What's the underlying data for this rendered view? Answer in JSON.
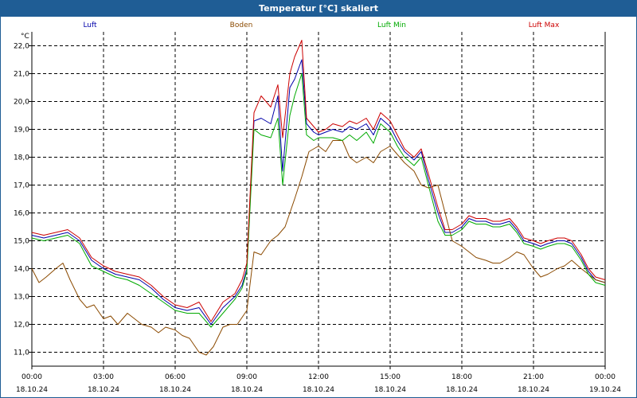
{
  "window": {
    "title": "Temperatur [°C] skaliert"
  },
  "chart_data": {
    "type": "line",
    "title": "Temperatur [°C] skaliert",
    "ylabel": "°C",
    "ylim": [
      10.5,
      22.5
    ],
    "yticks": [
      "11,0",
      "12,0",
      "13,0",
      "14,0",
      "15,0",
      "16,0",
      "17,0",
      "18,0",
      "19,0",
      "20,0",
      "21,0",
      "22,0"
    ],
    "ytick_values": [
      11,
      12,
      13,
      14,
      15,
      16,
      17,
      18,
      19,
      20,
      21,
      22
    ],
    "xlim": [
      0,
      24
    ],
    "xtick_values": [
      0,
      3,
      6,
      9,
      12,
      15,
      18,
      21,
      24
    ],
    "xticks_time": [
      "00:00",
      "03:00",
      "06:00",
      "09:00",
      "12:00",
      "15:00",
      "18:00",
      "21:00",
      "00:00"
    ],
    "xticks_date": [
      "18.10.24",
      "18.10.24",
      "18.10.24",
      "18.10.24",
      "18.10.24",
      "18.10.24",
      "18.10.24",
      "18.10.24",
      "19.10.24"
    ],
    "grid": true,
    "legend_position": "top",
    "series": [
      {
        "name": "Luft",
        "color": "#0000aa",
        "x": [
          0,
          0.5,
          1,
          1.5,
          2,
          2.5,
          3,
          3.5,
          4,
          4.5,
          5,
          5.5,
          6,
          6.5,
          7,
          7.5,
          8,
          8.5,
          8.8,
          9,
          9.3,
          9.6,
          10,
          10.3,
          10.5,
          10.8,
          11,
          11.3,
          11.5,
          11.8,
          12,
          12.3,
          12.6,
          13,
          13.3,
          13.6,
          14,
          14.3,
          14.6,
          15,
          15.3,
          15.6,
          16,
          16.3,
          16.6,
          17,
          17.3,
          17.6,
          18,
          18.3,
          18.6,
          19,
          19.3,
          19.6,
          20,
          20.3,
          20.6,
          21,
          21.3,
          21.6,
          22,
          22.3,
          22.6,
          23,
          23.3,
          23.6,
          24
        ],
        "y": [
          15.2,
          15.1,
          15.2,
          15.3,
          15.0,
          14.3,
          14.0,
          13.8,
          13.7,
          13.6,
          13.3,
          12.9,
          12.6,
          12.5,
          12.6,
          12.0,
          12.6,
          13.0,
          13.4,
          14.0,
          19.3,
          19.4,
          19.2,
          20.2,
          17.5,
          20.5,
          20.8,
          21.5,
          19.2,
          18.9,
          18.8,
          18.9,
          19.0,
          18.9,
          19.1,
          19.0,
          19.2,
          18.8,
          19.4,
          19.1,
          18.6,
          18.2,
          17.9,
          18.2,
          17.2,
          16.0,
          15.3,
          15.3,
          15.5,
          15.8,
          15.7,
          15.7,
          15.6,
          15.6,
          15.7,
          15.4,
          15.0,
          14.9,
          14.8,
          14.9,
          15.0,
          15.0,
          14.9,
          14.4,
          13.9,
          13.6,
          13.5
        ]
      },
      {
        "name": "Boden",
        "color": "#8b4a00",
        "x": [
          0,
          0.3,
          0.6,
          1,
          1.3,
          1.6,
          2,
          2.3,
          2.6,
          3,
          3.3,
          3.6,
          4,
          4.3,
          4.6,
          5,
          5.3,
          5.6,
          6,
          6.3,
          6.6,
          7,
          7.3,
          7.6,
          8,
          8.3,
          8.6,
          9,
          9.3,
          9.6,
          10,
          10.3,
          10.6,
          11,
          11.3,
          11.6,
          12,
          12.3,
          12.6,
          13,
          13.3,
          13.6,
          14,
          14.3,
          14.6,
          15,
          15.3,
          15.6,
          16,
          16.3,
          16.6,
          17,
          17.3,
          17.6,
          18,
          18.3,
          18.6,
          19,
          19.3,
          19.6,
          20,
          20.3,
          20.6,
          21,
          21.3,
          21.6,
          22,
          22.3,
          22.6,
          23,
          23.3,
          23.6,
          24
        ],
        "y": [
          14.0,
          13.5,
          13.7,
          14.0,
          14.2,
          13.6,
          12.9,
          12.6,
          12.7,
          12.2,
          12.3,
          12.0,
          12.4,
          12.2,
          12.0,
          11.9,
          11.7,
          11.9,
          11.8,
          11.6,
          11.5,
          11.0,
          10.9,
          11.2,
          11.9,
          12.0,
          12.0,
          12.5,
          14.6,
          14.5,
          15.0,
          15.2,
          15.5,
          16.5,
          17.3,
          18.2,
          18.4,
          18.2,
          18.6,
          18.6,
          18.0,
          17.8,
          18.0,
          17.8,
          18.2,
          18.4,
          18.1,
          17.8,
          17.5,
          17.0,
          16.9,
          17.0,
          16.0,
          15.0,
          14.8,
          14.6,
          14.4,
          14.3,
          14.2,
          14.2,
          14.4,
          14.6,
          14.5,
          14.0,
          13.7,
          13.8,
          14.0,
          14.1,
          14.3,
          14.0,
          13.8,
          13.6,
          13.5
        ]
      },
      {
        "name": "Luft Min",
        "color": "#00aa00",
        "x": [
          0,
          0.5,
          1,
          1.5,
          2,
          2.5,
          3,
          3.5,
          4,
          4.5,
          5,
          5.5,
          6,
          6.5,
          7,
          7.5,
          8,
          8.5,
          8.8,
          9,
          9.3,
          9.6,
          10,
          10.3,
          10.5,
          10.8,
          11,
          11.3,
          11.5,
          11.8,
          12,
          12.3,
          12.6,
          13,
          13.3,
          13.6,
          14,
          14.3,
          14.6,
          15,
          15.3,
          15.6,
          16,
          16.3,
          16.6,
          17,
          17.3,
          17.6,
          18,
          18.3,
          18.6,
          19,
          19.3,
          19.6,
          20,
          20.3,
          20.6,
          21,
          21.3,
          21.6,
          22,
          22.3,
          22.6,
          23,
          23.3,
          23.6,
          24
        ],
        "y": [
          15.1,
          15.0,
          15.1,
          15.2,
          14.9,
          14.1,
          13.9,
          13.7,
          13.6,
          13.4,
          13.1,
          12.8,
          12.5,
          12.4,
          12.4,
          11.9,
          12.4,
          12.9,
          13.3,
          13.9,
          19.0,
          18.8,
          18.7,
          19.4,
          17.0,
          19.5,
          20.2,
          21.0,
          18.8,
          18.6,
          18.7,
          18.7,
          18.7,
          18.6,
          18.8,
          18.6,
          18.9,
          18.5,
          19.2,
          18.9,
          18.4,
          18.0,
          17.7,
          18.0,
          17.0,
          15.7,
          15.2,
          15.2,
          15.4,
          15.7,
          15.6,
          15.6,
          15.5,
          15.5,
          15.6,
          15.3,
          14.9,
          14.8,
          14.7,
          14.8,
          14.9,
          14.9,
          14.8,
          14.3,
          13.8,
          13.5,
          13.4
        ]
      },
      {
        "name": "Luft Max",
        "color": "#cc0000",
        "x": [
          0,
          0.5,
          1,
          1.5,
          2,
          2.5,
          3,
          3.5,
          4,
          4.5,
          5,
          5.5,
          6,
          6.5,
          7,
          7.5,
          8,
          8.5,
          8.8,
          9,
          9.3,
          9.6,
          10,
          10.3,
          10.5,
          10.8,
          11,
          11.3,
          11.5,
          11.8,
          12,
          12.3,
          12.6,
          13,
          13.3,
          13.6,
          14,
          14.3,
          14.6,
          15,
          15.3,
          15.6,
          16,
          16.3,
          16.6,
          17,
          17.3,
          17.6,
          18,
          18.3,
          18.6,
          19,
          19.3,
          19.6,
          20,
          20.3,
          20.6,
          21,
          21.3,
          21.6,
          22,
          22.3,
          22.6,
          23,
          23.3,
          23.6,
          24
        ],
        "y": [
          15.3,
          15.2,
          15.3,
          15.4,
          15.1,
          14.4,
          14.1,
          13.9,
          13.8,
          13.7,
          13.4,
          13.0,
          12.7,
          12.6,
          12.8,
          12.1,
          12.8,
          13.1,
          13.6,
          14.2,
          19.6,
          20.2,
          19.8,
          20.6,
          18.7,
          21.0,
          21.6,
          22.2,
          19.4,
          19.1,
          18.9,
          19.0,
          19.2,
          19.1,
          19.3,
          19.2,
          19.4,
          19.0,
          19.6,
          19.3,
          18.8,
          18.3,
          18.0,
          18.3,
          17.4,
          16.2,
          15.4,
          15.4,
          15.6,
          15.9,
          15.8,
          15.8,
          15.7,
          15.7,
          15.8,
          15.5,
          15.1,
          15.0,
          14.9,
          15.0,
          15.1,
          15.1,
          15.0,
          14.5,
          14.0,
          13.7,
          13.6
        ]
      }
    ]
  }
}
